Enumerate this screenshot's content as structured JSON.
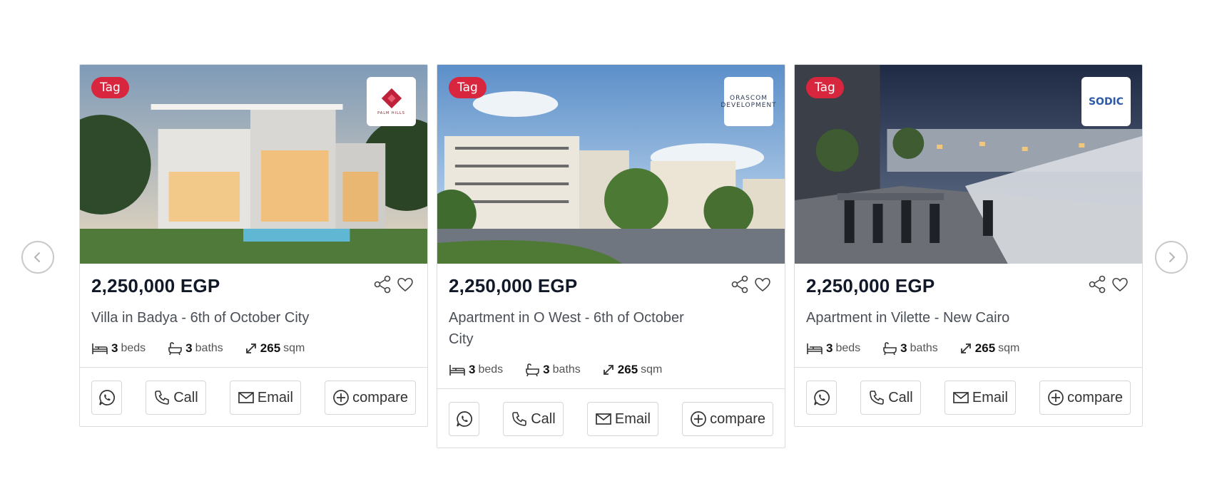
{
  "carousel": {
    "prev_icon": "chevron-left-icon",
    "next_icon": "chevron-right-icon"
  },
  "colors": {
    "tag_bg": "#d7263d",
    "price_text": "#111827",
    "border": "#dcdcdc"
  },
  "listings": [
    {
      "tag": "Tag",
      "developer_logo": "PALM HILLS",
      "price": "2,250,000 EGP",
      "title": "Villa in Badya - 6th of October City",
      "beds": "3",
      "beds_unit": "beds",
      "baths": "3",
      "baths_unit": "baths",
      "area": "265",
      "area_unit": "sqm",
      "call_label": "Call",
      "email_label": "Email",
      "compare_label": "compare"
    },
    {
      "tag": "Tag",
      "developer_logo": "ORASCOM DEVELOPMENT",
      "price": "2,250,000 EGP",
      "title": "Apartment in O West - 6th of October City",
      "beds": "3",
      "beds_unit": "beds",
      "baths": "3",
      "baths_unit": "baths",
      "area": "265",
      "area_unit": "sqm",
      "call_label": "Call",
      "email_label": "Email",
      "compare_label": "compare"
    },
    {
      "tag": "Tag",
      "developer_logo": "SODIC",
      "price": "2,250,000 EGP",
      "title": "Apartment in Vilette - New Cairo",
      "beds": "3",
      "beds_unit": "beds",
      "baths": "3",
      "baths_unit": "baths",
      "area": "265",
      "area_unit": "sqm",
      "call_label": "Call",
      "email_label": "Email",
      "compare_label": "compare"
    }
  ]
}
